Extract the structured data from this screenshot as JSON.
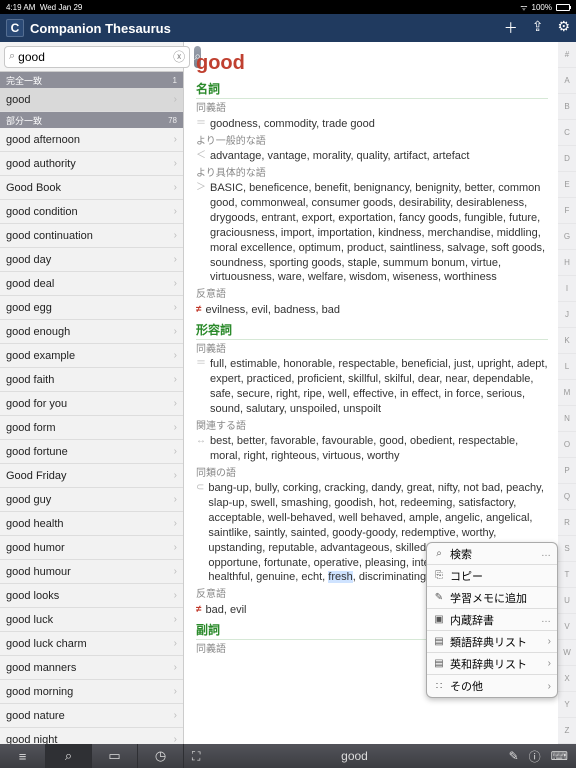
{
  "status": {
    "time": "4:19 AM",
    "date": "Wed Jan 29",
    "wifi": "⋮",
    "battery_pct": "100%"
  },
  "nav": {
    "logo_letter": "C",
    "title": "Companion Thesaurus",
    "add_icon": "add-icon",
    "share_icon": "share-icon",
    "settings_icon": "gear-icon"
  },
  "search": {
    "query": "good",
    "placeholder": ""
  },
  "list": {
    "section1_label": "完全一致",
    "section1_count": "1",
    "section2_label": "部分一致",
    "section2_count": "78",
    "exact": [
      {
        "label": "good",
        "selected": true
      }
    ],
    "partial": [
      {
        "label": "good afternoon"
      },
      {
        "label": "good authority"
      },
      {
        "label": "Good Book"
      },
      {
        "label": "good condition"
      },
      {
        "label": "good continuation"
      },
      {
        "label": "good day"
      },
      {
        "label": "good deal"
      },
      {
        "label": "good egg"
      },
      {
        "label": "good enough"
      },
      {
        "label": "good example"
      },
      {
        "label": "good faith"
      },
      {
        "label": "good for you"
      },
      {
        "label": "good form"
      },
      {
        "label": "good fortune"
      },
      {
        "label": "Good Friday"
      },
      {
        "label": "good guy"
      },
      {
        "label": "good health"
      },
      {
        "label": "good humor"
      },
      {
        "label": "good humour"
      },
      {
        "label": "good looks"
      },
      {
        "label": "good luck"
      },
      {
        "label": "good luck charm"
      },
      {
        "label": "good manners"
      },
      {
        "label": "good morning"
      },
      {
        "label": "good nature"
      },
      {
        "label": "good night"
      }
    ]
  },
  "entry": {
    "headword": "good",
    "pos1": "名詞",
    "n_syn_label": "同義語",
    "n_syn": "goodness, commodity, trade good",
    "n_gen_label": "より一般的な語",
    "n_gen": "advantage, vantage, morality, quality, artifact, artefact",
    "n_spec_label": "より具体的な語",
    "n_spec": "BASIC, beneficence, benefit, benignancy, benignity, better, common good, commonweal, consumer goods, desirability, desirableness, drygoods, entrant, export, exportation, fancy goods, fungible, future, graciousness, import, importation, kindness, merchandise, middling, moral excellence, optimum, product, saintliness, salvage, soft goods, soundness, sporting goods, staple, summum bonum, virtue, virtuousness, ware, welfare, wisdom, wiseness, worthiness",
    "n_ant_label": "反意語",
    "n_ant": "evilness, evil, badness, bad",
    "pos2": "形容詞",
    "a_syn_label": "同義語",
    "a_syn": "full, estimable, honorable, respectable, beneficial, just, upright, adept, expert, practiced, proficient, skillful, skilful, dear, near, dependable, safe, secure, right, ripe, well, effective, in effect, in force, serious, sound, salutary, unspoiled, unspoilt",
    "a_rel_label": "関連する語",
    "a_rel": "best, better, favorable, favourable, good, obedient, respectable, moral, right, righteous, virtuous, worthy",
    "a_sim_label": "同類の語",
    "a_sim_pre": "bang-up, bully, corking, cracking, dandy, great, nifty, not bad, peachy, slap-up, swell, smashing, goodish, hot, redeeming, satisfactory, acceptable, well-behaved, well behaved, ample, angelic, angelical, saintlike, saintly, sainted, goody-goody, redemptive, worthy, upstanding, reputable, advantageous, skilled, complete, close, sound, opportune, fortunate, operative, pleasing, intellectual, healthy, healthful, genuine, echt, ",
    "a_sim_sel": "fresh",
    "a_sim_post": ", discriminating",
    "a_ant_label": "反意語",
    "a_ant": "bad, evil",
    "pos3": "副詞",
    "adv_syn_label": "同義語"
  },
  "alpha": [
    "#",
    "A",
    "B",
    "C",
    "D",
    "E",
    "F",
    "G",
    "H",
    "I",
    "J",
    "K",
    "L",
    "M",
    "N",
    "O",
    "P",
    "Q",
    "R",
    "S",
    "T",
    "U",
    "V",
    "W",
    "X",
    "Y",
    "Z"
  ],
  "popup": [
    {
      "icon": "⌕",
      "label": "検索",
      "tail": "…"
    },
    {
      "icon": "⎘",
      "label": "コピー",
      "tail": ""
    },
    {
      "icon": "✎",
      "label": "学習メモに追加",
      "tail": ""
    },
    {
      "icon": "▣",
      "label": "内蔵辞書",
      "tail": "…"
    },
    {
      "icon": "▤",
      "label": "類語辞典リスト",
      "tail": "›"
    },
    {
      "icon": "▤",
      "label": "英和辞典リスト",
      "tail": "›"
    },
    {
      "icon": "∷",
      "label": "その他",
      "tail": "›"
    }
  ],
  "bottombar": {
    "center": "good"
  }
}
